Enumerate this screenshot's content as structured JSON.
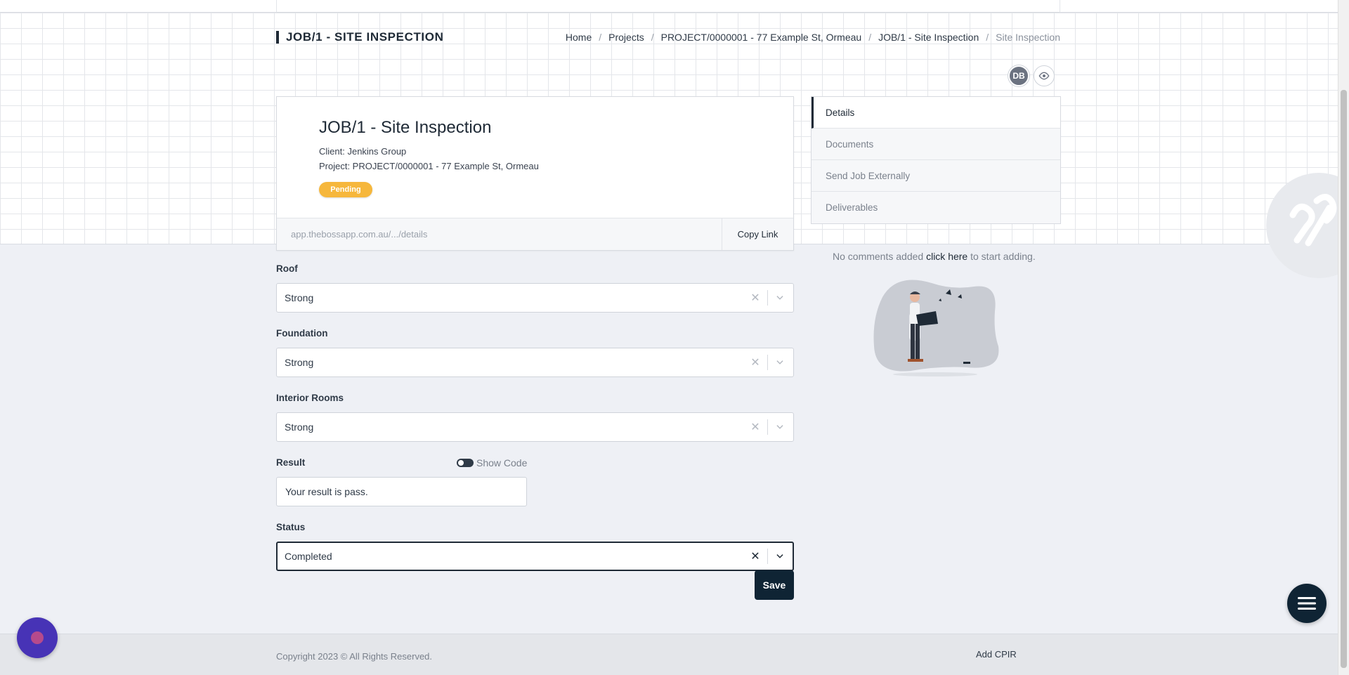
{
  "header": {
    "title": "JOB/1 - SITE INSPECTION",
    "breadcrumb": [
      "Home",
      "Projects",
      "PROJECT/0000001 - 77 Example St, Ormeau",
      "JOB/1 - Site Inspection",
      "Site Inspection"
    ]
  },
  "avatars": {
    "initials": "DB",
    "eye_icon": "eye-icon"
  },
  "job": {
    "title": "JOB/1 - Site Inspection",
    "client": "Client: Jenkins Group",
    "project": "Project: PROJECT/0000001 - 77 Example St, Ormeau",
    "status_badge": "Pending",
    "badge_color": "#f6b73c",
    "link_url": "app.thebossapp.com.au/.../details",
    "copy_link_label": "Copy Link"
  },
  "side_tabs": [
    {
      "label": "Details",
      "active": true
    },
    {
      "label": "Documents",
      "active": false
    },
    {
      "label": "Send Job Externally",
      "active": false
    },
    {
      "label": "Deliverables",
      "active": false
    }
  ],
  "form": {
    "roof": {
      "label": "Roof",
      "value": "Strong"
    },
    "foundation": {
      "label": "Foundation",
      "value": "Strong"
    },
    "interior": {
      "label": "Interior Rooms",
      "value": "Strong"
    },
    "result": {
      "label": "Result",
      "show_code_label": "Show Code",
      "value": "Your result is pass."
    },
    "status": {
      "label": "Status",
      "value": "Completed"
    },
    "save_label": "Save"
  },
  "comments": {
    "prefix": "No comments added",
    "link": "click here",
    "suffix": "to start adding."
  },
  "footer": {
    "copyright": "Copyright 2023 © All Rights Reserved.",
    "add_cpir": "Add CPIR"
  },
  "colors": {
    "primary": "#0f2434",
    "chat": "#4733b6"
  }
}
